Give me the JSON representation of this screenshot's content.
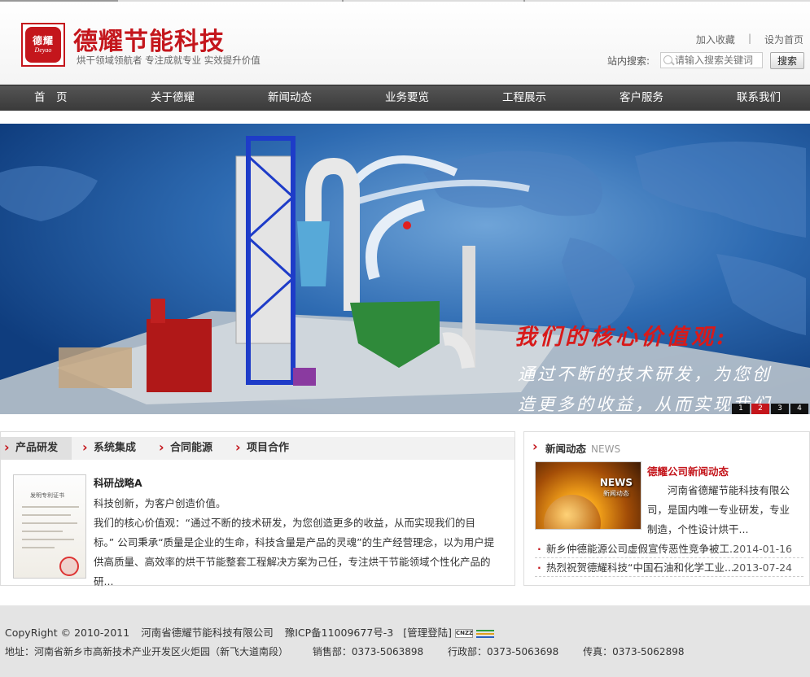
{
  "header": {
    "logo_zh": "德耀",
    "logo_en": "Deyao",
    "brand": "德耀节能科技",
    "slogan": "烘干领域领航者 专注成就专业 实效提升价值",
    "links": [
      "加入收藏",
      "设为首页"
    ],
    "link_separator": "|",
    "search_label": "站内搜索:",
    "search_placeholder": "请输入搜索关键词",
    "search_button": "搜索"
  },
  "nav": [
    "首　页",
    "关于德耀",
    "新闻动态",
    "业务要览",
    "工程展示",
    "客户服务",
    "联系我们"
  ],
  "banner": {
    "title": "我们的核心价值观:",
    "text": "通过不断的技术研发，为您创造更多的收益，从而实现我们的目标。",
    "pager": [
      "1",
      "2",
      "3",
      "4"
    ],
    "active_page": "2"
  },
  "products": {
    "tabs": [
      "产品研发",
      "系统集成",
      "合同能源",
      "项目合作"
    ],
    "cert_title": "发明专利证书",
    "article_title": "科研战略A",
    "article_lines": [
      "科技创新，为客户创造价值。",
      "我们的核心价值观：“通过不断的技术研发，为您创造更多的收益，从而实现我们的目",
      "标。” 公司秉承“质量是企业的生命，科技含量是产品的灵魂”的生产经营理念，以为用户提",
      "供高质量、高效率的烘干节能整套工程解决方案为己任，专注烘干节能领域个性化产品的研..."
    ]
  },
  "news": {
    "title": "新闻动态",
    "title_en": "NEWS",
    "image_label": "NEWS",
    "image_sublabel": "新闻动态",
    "feature_title": "德耀公司新闻动态",
    "feature_body": "河南省德耀节能科技有限公司，是国内唯一专业研发，专业制造，个性设计烘干...",
    "items": [
      {
        "title": "新乡仲德能源公司虚假宣传恶性竞争被工...",
        "date": "2014-01-16"
      },
      {
        "title": "热烈祝贺德耀科技“中国石油和化学工业...",
        "date": "2013-07-24"
      }
    ]
  },
  "footer": {
    "copyright": "CopyRight © 2010-2011",
    "company": "河南省德耀节能科技有限公司",
    "icp": "豫ICP备11009677号-3",
    "admin": "[管理登陆]",
    "cnzz": "CNZZ",
    "address": "地址：河南省新乡市高新技术产业开发区火炬园（新飞大道南段）",
    "sales": "销售部：0373-5063898",
    "admin_dept": "行政部：0373-5063698",
    "fax": "传真：0373-5062898"
  },
  "colors": {
    "brand_red": "#c4161c",
    "nav_bg": "#444444",
    "footer_bg": "#e4e4e4"
  }
}
